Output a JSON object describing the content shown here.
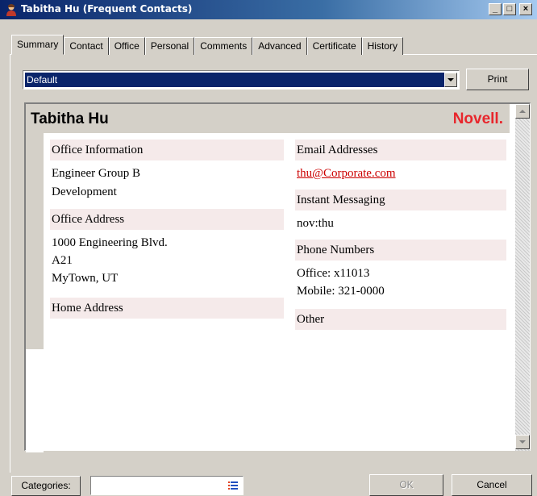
{
  "window": {
    "title": "Tabitha Hu (Frequent Contacts)",
    "controls": {
      "minimize": "_",
      "maximize": "□",
      "close": "×"
    }
  },
  "tabs": [
    {
      "label": "Summary",
      "active": true
    },
    {
      "label": "Contact"
    },
    {
      "label": "Office"
    },
    {
      "label": "Personal"
    },
    {
      "label": "Comments"
    },
    {
      "label": "Advanced"
    },
    {
      "label": "Certificate"
    },
    {
      "label": "History"
    }
  ],
  "view": {
    "selected": "Default"
  },
  "buttons": {
    "print": "Print",
    "categories": "Categories:",
    "ok": "OK",
    "cancel": "Cancel"
  },
  "card": {
    "name": "Tabitha Hu",
    "brand": "Novell.",
    "left": {
      "office_info_label": "Office Information",
      "office_info": [
        "Engineer Group B",
        "Development"
      ],
      "office_address_label": "Office Address",
      "office_address": [
        "1000 Engineering Blvd.",
        "A21",
        "MyTown, UT"
      ],
      "home_address_label": "Home Address"
    },
    "right": {
      "email_label": "Email Addresses",
      "email": "thu@Corporate.com",
      "im_label": "Instant Messaging",
      "im": "nov:thu",
      "phone_label": "Phone Numbers",
      "phones": [
        "Office: x11013",
        "Mobile: 321-0000"
      ],
      "other_label": "Other"
    }
  },
  "categories": {
    "value": ""
  },
  "colors": {
    "selection": "#0a246a",
    "brand": "#e8262c",
    "link": "#cc0000",
    "section": "#f5eaea"
  },
  "icons": [
    "contact-icon",
    "list-icon",
    "dropdown-arrow-icon",
    "scroll-up-icon",
    "scroll-down-icon"
  ]
}
